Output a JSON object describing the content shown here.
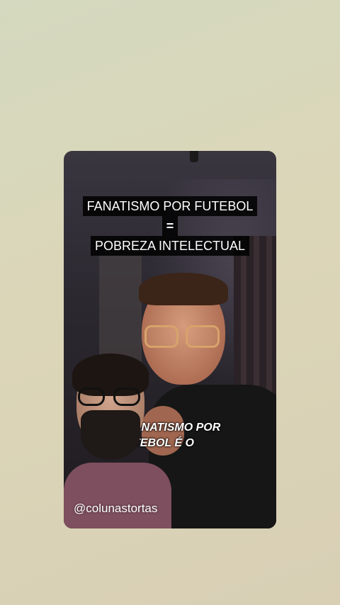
{
  "video": {
    "caption_line1": "FANATISMO POR FUTEBOL",
    "caption_line2": "=",
    "caption_line3": "POBREZA INTELECTUAL",
    "overlay_line1": "ANATISMO POR",
    "overlay_line2": "TEBOL É O",
    "handle": "@colunastortas"
  },
  "colors": {
    "background": "#d6d4b9",
    "caption_bg": "#000000",
    "caption_text": "#ffffff"
  }
}
